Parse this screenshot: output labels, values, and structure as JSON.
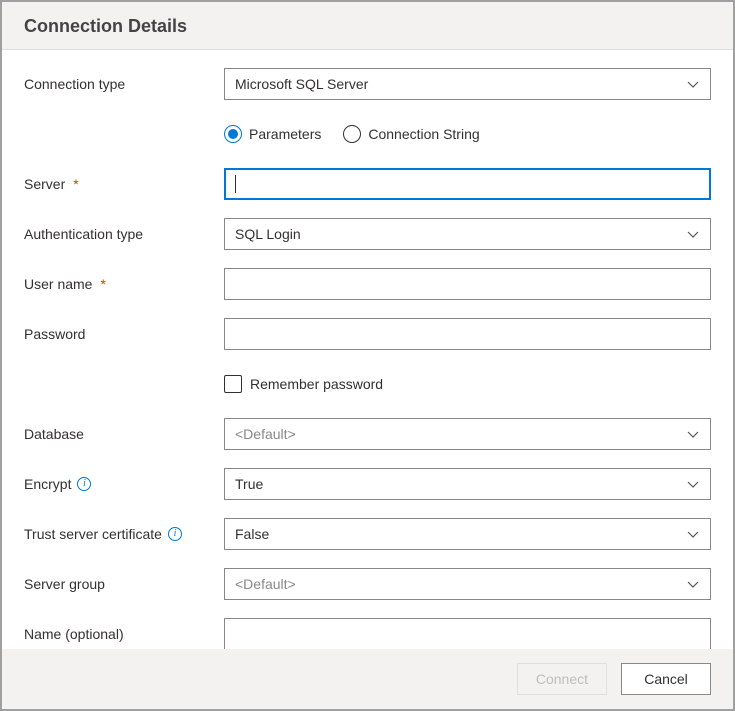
{
  "header": {
    "title": "Connection Details"
  },
  "labels": {
    "connection_type": "Connection type",
    "server": "Server",
    "auth_type": "Authentication type",
    "user_name": "User name",
    "password": "Password",
    "remember_password": "Remember password",
    "database": "Database",
    "encrypt": "Encrypt",
    "trust_cert": "Trust server certificate",
    "server_group": "Server group",
    "name_optional": "Name (optional)"
  },
  "values": {
    "connection_type": "Microsoft SQL Server",
    "server": "",
    "auth_type": "SQL Login",
    "user_name": "",
    "password": "",
    "remember_password_checked": false,
    "database": "<Default>",
    "encrypt": "True",
    "trust_cert": "False",
    "server_group": "<Default>",
    "name_optional": ""
  },
  "radio": {
    "parameters": "Parameters",
    "connection_string": "Connection String",
    "selected": "parameters"
  },
  "footer": {
    "connect": "Connect",
    "cancel": "Cancel",
    "connect_enabled": false
  },
  "asterisk": "*",
  "info_glyph": "i"
}
